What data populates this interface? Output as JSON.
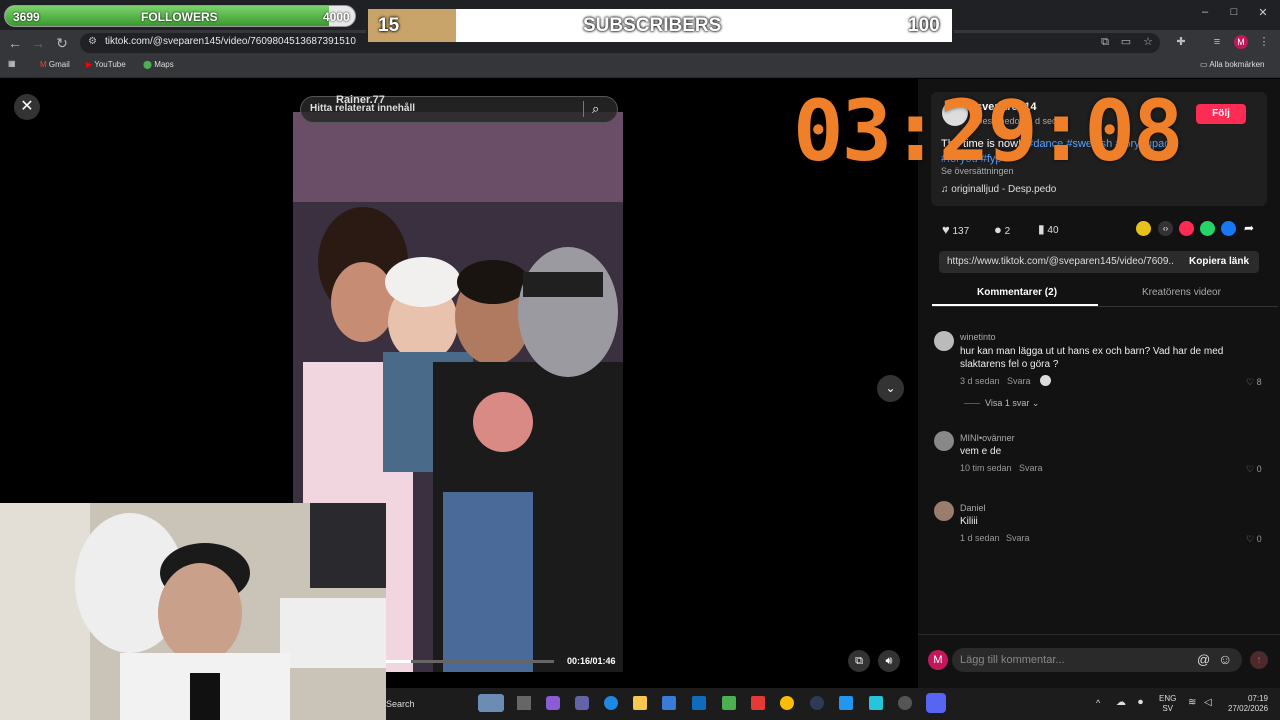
{
  "overlay": {
    "followers": {
      "current": "3699",
      "label": "FOLLOWERS",
      "goal": "4000",
      "progress": 0.925
    },
    "subscribers": {
      "current": "15",
      "label": "SUBSCRIBERS",
      "goal": "100",
      "progress": 0.15
    },
    "timer": "03:29:08"
  },
  "browser": {
    "url": "tiktok.com/@sveparen145/video/7609804513687391510",
    "bookmarks": [
      "Gmail",
      "YouTube",
      "Maps"
    ],
    "all_bookmarks": "Alla bokmärken",
    "profile_initial": "M"
  },
  "video": {
    "search_placeholder": "Hitta relaterat innehåll",
    "watermark": "Rainer.77",
    "time": "00:16/01:46",
    "progress": 0.15
  },
  "post": {
    "author": "sveparen14",
    "author_sub": "Desp.pedo · 4 d sedan",
    "follow_label": "Följ",
    "caption_prefix": "The time is now!!",
    "hashtags": "#dance #swedish #foryoupage",
    "hashtags2": "#foryou #fyp",
    "see_translation": "Se översättningen",
    "sound": "originalljud - Desp.pedo",
    "likes": "137",
    "comments": "2",
    "saves": "40",
    "link": "https://www.tiktok.com/@sveparen145/video/7609...",
    "copy_label": "Kopiera länk"
  },
  "tabs": {
    "comments": "Kommentarer (2)",
    "creator": "Kreatörens videor"
  },
  "comments": [
    {
      "name": "winetinto",
      "text": "hur kan man lägga ut ut hans ex och barn? Vad har de med slaktarens fel o göra ?",
      "time": "3 d sedan",
      "reply": "Svara",
      "likes": "8",
      "replies": "Visa 1 svar"
    },
    {
      "name": "MINI•ovänner",
      "text": "vem e de",
      "time": "10 tim sedan",
      "reply": "Svara",
      "likes": "0"
    },
    {
      "name": "Daniel",
      "text": "Kiliii",
      "time": "1 d sedan",
      "reply": "Svara",
      "likes": "0"
    }
  ],
  "comment_input": {
    "placeholder": "Lägg till kommentar..."
  },
  "taskbar": {
    "search": "Search",
    "lang": "ENG",
    "lang_sub": "SV",
    "time": "07:19",
    "date": "27/02/2026"
  }
}
